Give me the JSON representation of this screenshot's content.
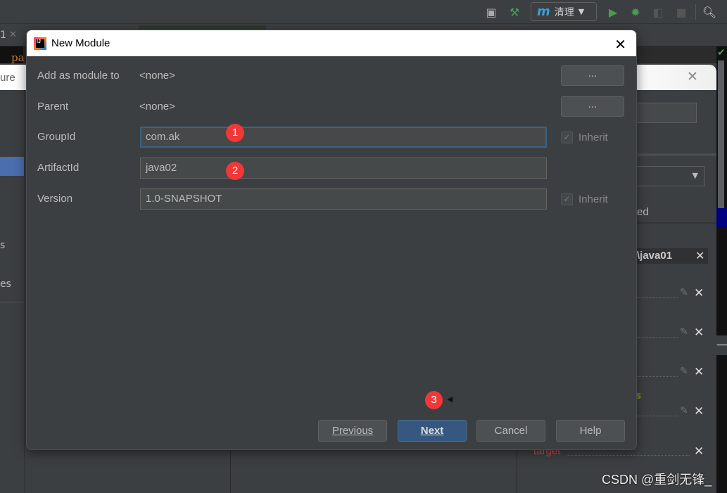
{
  "toolbar": {
    "run_config": "清理",
    "run_config_icon": "maven-m-icon",
    "m": "m"
  },
  "background": {
    "tab_label": "1",
    "editor_text": "pa",
    "left_text_1": "ure",
    "left_text_2": "s",
    "left_text_3": "es",
    "right_text_ed": "ed",
    "right_header": "\\java01",
    "right_text_s": "s",
    "target": "target"
  },
  "dialog": {
    "title": "New Module",
    "fields": {
      "add_as_module_to": {
        "label": "Add as module to",
        "value": "<none>"
      },
      "parent": {
        "label": "Parent",
        "value": "<none>"
      },
      "group_id": {
        "label": "GroupId",
        "value": "com.ak",
        "inherit": "Inherit",
        "inherit_checked": true
      },
      "artifact_id": {
        "label": "ArtifactId",
        "value": "java02"
      },
      "version": {
        "label": "Version",
        "value": "1.0-SNAPSHOT",
        "inherit": "Inherit",
        "inherit_checked": true
      }
    },
    "browse_label": "...",
    "buttons": {
      "previous": "Previous",
      "next": "Next",
      "cancel": "Cancel",
      "help": "Help"
    }
  },
  "annotations": [
    "1",
    "2",
    "3"
  ],
  "watermark": "CSDN @重剑无锋_",
  "colors": {
    "accent": "#365880",
    "badge": "#f03838",
    "focus_border": "#3d6185"
  }
}
